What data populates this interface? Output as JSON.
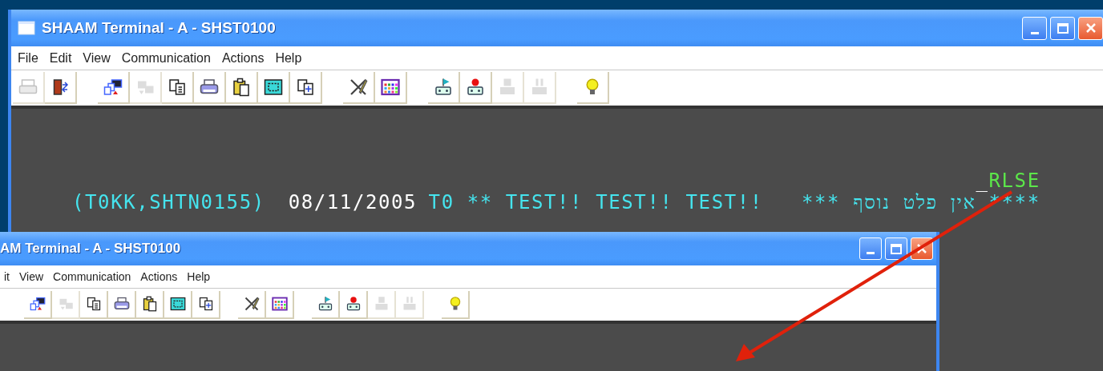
{
  "windows": [
    {
      "title": "SHAAM Terminal - A - SHST0100",
      "app_icon": true,
      "menu": [
        "File",
        "Edit",
        "View",
        "Communication",
        "Actions",
        "Help"
      ],
      "toolbar": [
        [
          {
            "kind": "printer",
            "disabled": true
          },
          {
            "kind": "exit",
            "disabled": false
          }
        ],
        [
          {
            "kind": "windows",
            "disabled": false
          },
          {
            "kind": "transfer",
            "disabled": true
          },
          {
            "kind": "copy",
            "disabled": false
          },
          {
            "kind": "print",
            "disabled": false
          },
          {
            "kind": "paste",
            "disabled": false
          },
          {
            "kind": "select",
            "disabled": false
          },
          {
            "kind": "copyplus",
            "disabled": false
          }
        ],
        [
          {
            "kind": "tools",
            "disabled": false
          },
          {
            "kind": "grid",
            "disabled": false
          }
        ],
        [
          {
            "kind": "play",
            "disabled": false
          },
          {
            "kind": "record",
            "disabled": false
          },
          {
            "kind": "stop",
            "disabled": true
          },
          {
            "kind": "pause",
            "disabled": true
          }
        ],
        [
          {
            "kind": "bulb",
            "disabled": false
          }
        ]
      ],
      "terminal": {
        "lines": [
          {
            "kind": "input",
            "segments": [
              {
                "text": "_",
                "color": "#ffffff"
              },
              {
                "text": "RLSE",
                "color": "#5ce64a"
              }
            ]
          },
          {
            "kind": "output",
            "segments": [
              {
                "text": "(T0KK,SHTN0155)",
                "color": "#45e4ee"
              },
              {
                "text": "08/11/2005",
                "color": "#ffffff"
              },
              {
                "text": "T0 ** TEST!! TEST!! TEST!!   *** אין פלט נוסף ****",
                "color": "#45e4ee"
              }
            ]
          }
        ]
      }
    },
    {
      "title": "AM Terminal - A - SHST0100",
      "app_icon": false,
      "menu": [
        "it",
        "View",
        "Communication",
        "Actions",
        "Help"
      ],
      "toolbar": [
        [
          {
            "kind": "windows",
            "disabled": false
          },
          {
            "kind": "transfer",
            "disabled": true
          },
          {
            "kind": "copy",
            "disabled": false
          },
          {
            "kind": "print",
            "disabled": false
          },
          {
            "kind": "paste",
            "disabled": false
          },
          {
            "kind": "select",
            "disabled": false
          },
          {
            "kind": "copyplus",
            "disabled": false
          }
        ],
        [
          {
            "kind": "tools",
            "disabled": false
          },
          {
            "kind": "grid",
            "disabled": false
          }
        ],
        [
          {
            "kind": "play",
            "disabled": false
          },
          {
            "kind": "record",
            "disabled": false
          },
          {
            "kind": "stop",
            "disabled": true
          },
          {
            "kind": "pause",
            "disabled": true
          }
        ],
        [
          {
            "kind": "bulb",
            "disabled": false
          }
        ]
      ]
    }
  ]
}
